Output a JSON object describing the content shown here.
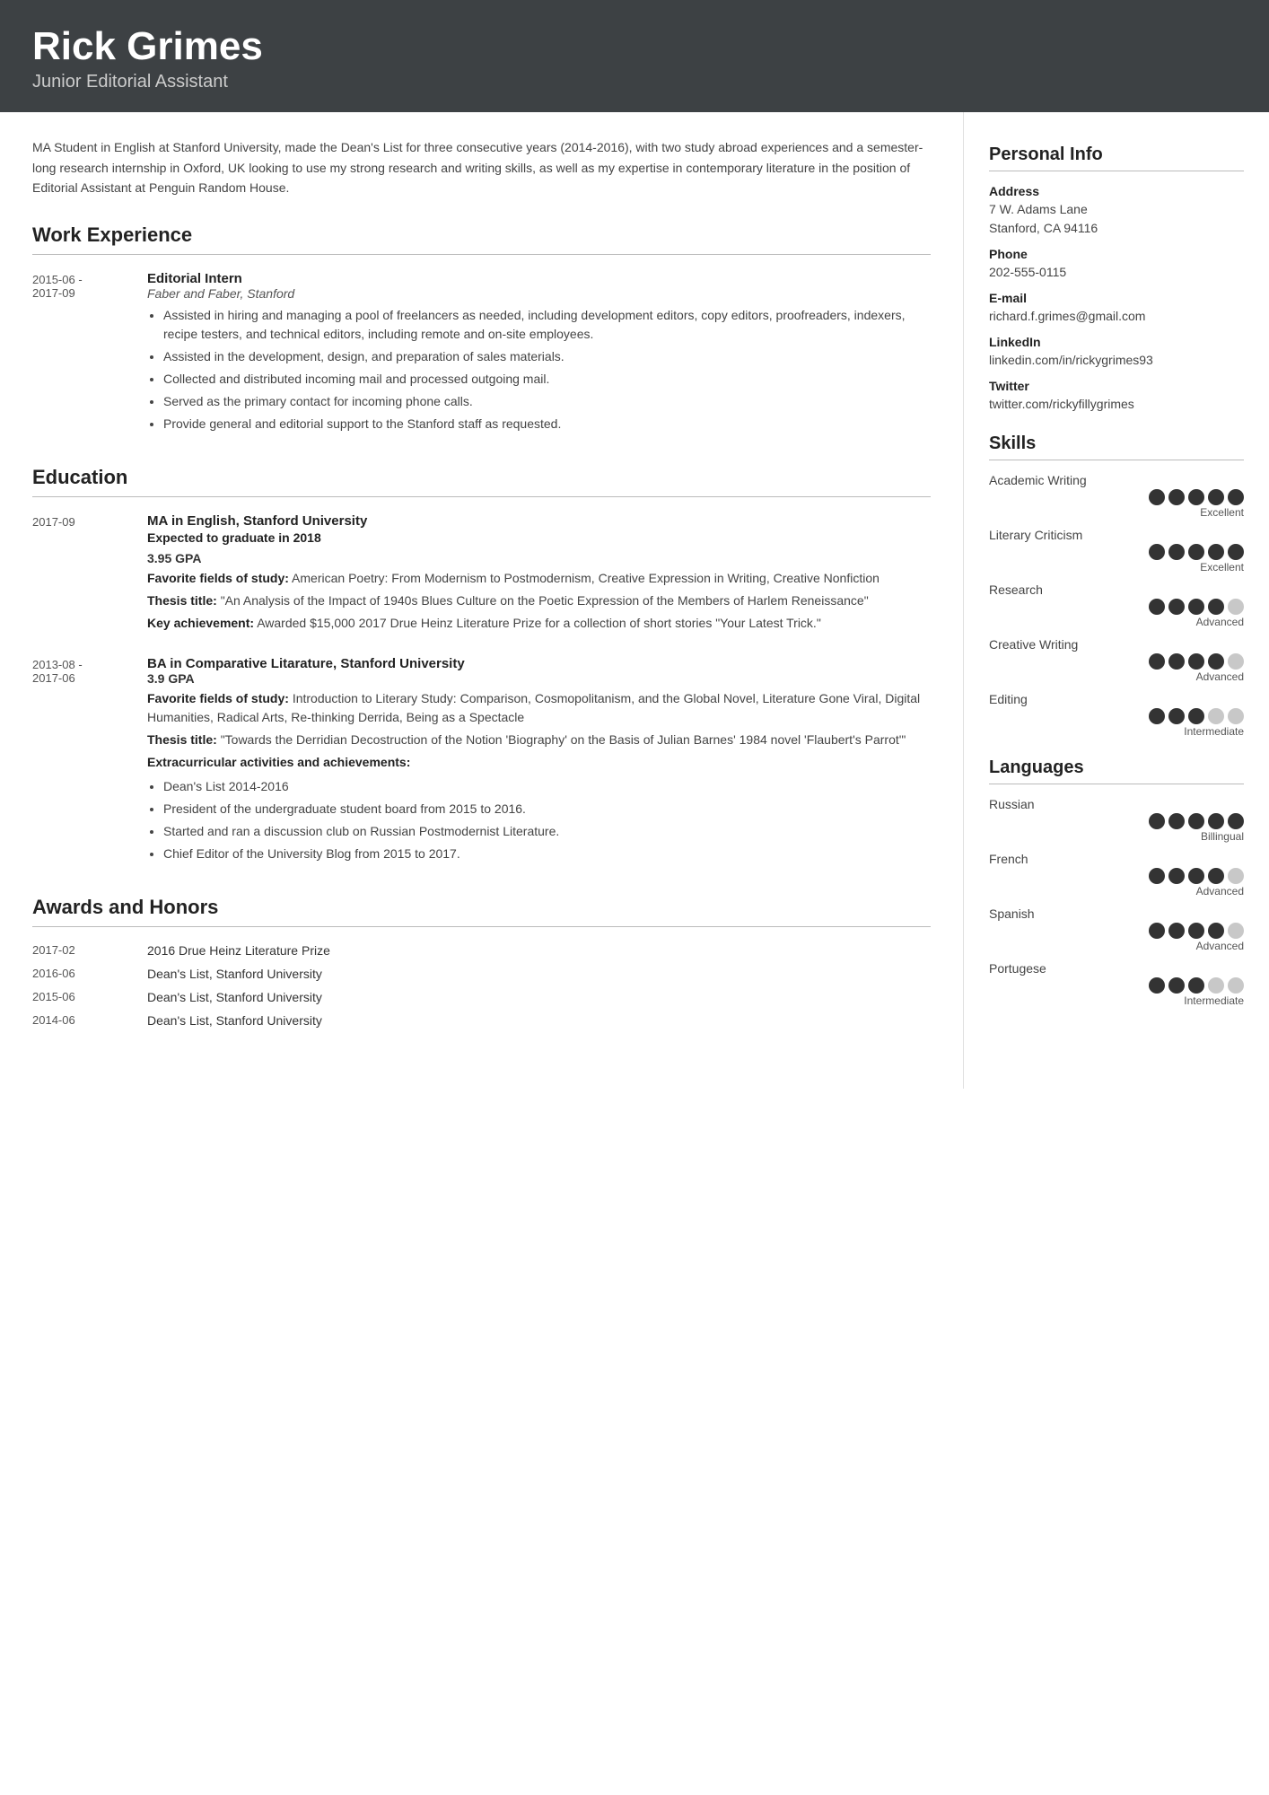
{
  "header": {
    "name": "Rick Grimes",
    "title": "Junior Editorial Assistant"
  },
  "summary": "MA Student in English at Stanford University, made the Dean's List for three consecutive years (2014-2016), with two study abroad experiences and a semester-long research internship in Oxford, UK looking to use my strong research and writing skills, as well as my expertise in contemporary literature in the position of Editorial Assistant at Penguin Random House.",
  "sections": {
    "work": {
      "label": "Work Experience",
      "entries": [
        {
          "date_start": "2015-06 -",
          "date_end": "2017-09",
          "title": "Editorial Intern",
          "subtitle": "Faber and Faber, Stanford",
          "bullets": [
            "Assisted in hiring and managing a pool of freelancers as needed, including development editors, copy editors, proofreaders, indexers, recipe testers, and technical editors, including remote and on-site employees.",
            "Assisted in the development, design, and preparation of sales materials.",
            "Collected and distributed incoming mail and processed outgoing mail.",
            "Served as the primary contact for incoming phone calls.",
            "Provide general and editorial support to the Stanford staff as requested."
          ]
        }
      ]
    },
    "education": {
      "label": "Education",
      "entries": [
        {
          "date": "2017-09",
          "title": "MA in English, Stanford University",
          "expected": "Expected to graduate in 2018",
          "gpa": "3.95 GPA",
          "favorite_label": "Favorite fields of study:",
          "favorite": "American Poetry: From Modernism to Postmodernism, Creative Expression in Writing, Creative Nonfiction",
          "thesis_label": "Thesis title:",
          "thesis": "\"An Analysis of the Impact of 1940s Blues Culture on the Poetic Expression of the Members of Harlem Reneissance\"",
          "achievement_label": "Key achievement:",
          "achievement": "Awarded $15,000 2017 Drue Heinz Literature Prize for a collection of short stories \"Your Latest Trick.\""
        },
        {
          "date_start": "2013-08 -",
          "date_end": "2017-06",
          "title": "BA in Comparative Litarature, Stanford University",
          "gpa": "3.9 GPA",
          "favorite_label": "Favorite fields of study:",
          "favorite": "Introduction to Literary Study: Comparison, Cosmopolitanism, and the Global Novel, Literature Gone Viral, Digital Humanities, Radical Arts, Re-thinking Derrida, Being as a Spectacle",
          "thesis_label": "Thesis title:",
          "thesis": "\"Towards the Derridian Decostruction of the Notion 'Biography' on the Basis of Julian Barnes' 1984 novel 'Flaubert's Parrot'\"",
          "extra_label": "Extracurricular activities and achievements:",
          "bullets": [
            "Dean's List 2014-2016",
            "President of the undergraduate student board from 2015 to 2016.",
            "Started and ran a discussion club on Russian Postmodernist Literature.",
            "Chief Editor of the University Blog from 2015 to 2017."
          ]
        }
      ]
    },
    "awards": {
      "label": "Awards and Honors",
      "entries": [
        {
          "date": "2017-02",
          "title": "2016 Drue Heinz Literature Prize"
        },
        {
          "date": "2016-06",
          "title": "Dean's List, Stanford University"
        },
        {
          "date": "2015-06",
          "title": "Dean's List, Stanford University"
        },
        {
          "date": "2014-06",
          "title": "Dean's List, Stanford University"
        }
      ]
    }
  },
  "sidebar": {
    "personal_info": {
      "label": "Personal Info",
      "address_label": "Address",
      "address": "7 W. Adams Lane\nStanford, CA 94116",
      "phone_label": "Phone",
      "phone": "202-555-0115",
      "email_label": "E-mail",
      "email": "richard.f.grimes@gmail.com",
      "linkedin_label": "LinkedIn",
      "linkedin": "linkedin.com/in/rickygrimes93",
      "twitter_label": "Twitter",
      "twitter": "twitter.com/rickyfillygrimes"
    },
    "skills": {
      "label": "Skills",
      "items": [
        {
          "name": "Academic Writing",
          "level": 5,
          "max": 5,
          "label": "Excellent"
        },
        {
          "name": "Literary Criticism",
          "level": 5,
          "max": 5,
          "label": "Excellent"
        },
        {
          "name": "Research",
          "level": 4,
          "max": 5,
          "label": "Advanced"
        },
        {
          "name": "Creative Writing",
          "level": 4,
          "max": 5,
          "label": "Advanced"
        },
        {
          "name": "Editing",
          "level": 3,
          "max": 5,
          "label": "Intermediate"
        }
      ]
    },
    "languages": {
      "label": "Languages",
      "items": [
        {
          "name": "Russian",
          "level": 5,
          "max": 5,
          "label": "Billingual"
        },
        {
          "name": "French",
          "level": 4,
          "max": 5,
          "label": "Advanced"
        },
        {
          "name": "Spanish",
          "level": 4,
          "max": 5,
          "label": "Advanced"
        },
        {
          "name": "Portugese",
          "level": 3,
          "max": 5,
          "label": "Intermediate"
        }
      ]
    }
  }
}
